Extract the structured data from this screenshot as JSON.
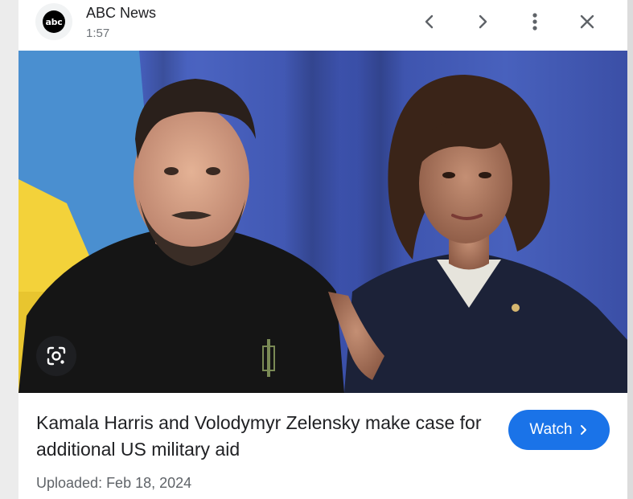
{
  "header": {
    "source_logo_text": "abc",
    "source_name": "ABC News",
    "duration": "1:57",
    "icons": [
      "chevron-left-icon",
      "chevron-right-icon",
      "more-vert-icon",
      "close-icon"
    ]
  },
  "media": {
    "lens_icon": "google-lens-icon"
  },
  "content": {
    "title": "Kamala Harris and Volodymyr Zelensky make case for additional US military aid",
    "watch_label": "Watch",
    "uploaded": "Uploaded: Feb 18, 2024"
  },
  "colors": {
    "accent": "#1a73e8",
    "text_primary": "#202124",
    "text_secondary": "#5f6368"
  }
}
